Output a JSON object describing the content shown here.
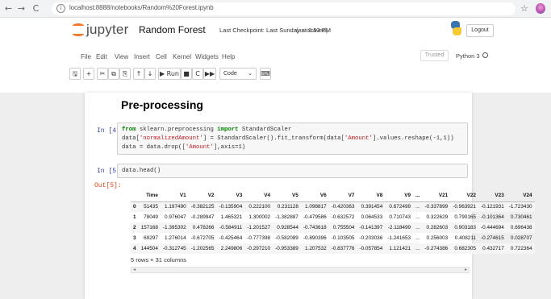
{
  "browser": {
    "back": "←",
    "forward": "→",
    "reload": "C",
    "info_icon": "i",
    "url": "localhost:8888/notebooks/Random%20Forest.ipynb",
    "star": "☆"
  },
  "jupyter": {
    "brand": "jupyter",
    "notebook_title": "Random Forest",
    "checkpoint": "Last Checkpoint: Last Sunday at 8:53 PM",
    "autosave": "(autosaved)",
    "logout": "Logout",
    "trusted": "Trusted",
    "kernel": "Python 3"
  },
  "menu": [
    "File",
    "Edit",
    "View",
    "Insert",
    "Cell",
    "Kernel",
    "Widgets",
    "Help"
  ],
  "toolbar": {
    "save": "🖫",
    "add": "+",
    "cut": "✂",
    "copy": "⧉",
    "paste": "⎘",
    "up": "↑",
    "down": "↓",
    "run": "▶ Run",
    "stop": "■",
    "restart": "C",
    "run_all": "▶▶",
    "cell_type": "Code",
    "cell_type_arrow": "⌄",
    "palette": "⌨"
  },
  "notebook": {
    "heading": "Pre-processing",
    "cell4": {
      "prompt": "In [4]:",
      "line1_kw1": "from",
      "line1_mod": " sklearn.preprocessing ",
      "line1_kw2": "import",
      "line1_rest": " StandardScaler",
      "line2_a": "data[",
      "line2_s1": "'normalizedAmount'",
      "line2_b": "] = StandardScaler().fit_transform(data[",
      "line2_s2": "'Amount'",
      "line2_c": "].values.reshape(-1,1))",
      "line3_a": "data = data.drop([",
      "line3_s": "'Amount'",
      "line3_b": "],axis=1)"
    },
    "cell5": {
      "prompt": "In [5]:",
      "code": "data.head()",
      "out_prompt": "Out[5]:"
    },
    "dataframe": {
      "columns": [
        "",
        "Time",
        "V1",
        "V2",
        "V3",
        "V4",
        "V5",
        "V6",
        "V7",
        "V8",
        "V9",
        "...",
        "V21",
        "V22",
        "V23",
        "V24"
      ],
      "rows": [
        [
          "0",
          "51435",
          "1.197490",
          "-0.382125",
          "-0.135904",
          "0.222100",
          "0.231128",
          "1.098817",
          "-0.420363",
          "0.391454",
          "0.672499",
          "...",
          "-0.337899",
          "-0.963921",
          "-0.121931",
          "-1.723430"
        ],
        [
          "1",
          "78049",
          "0.976047",
          "-0.289947",
          "1.465321",
          "1.300002",
          "-1.382887",
          "-0.479586",
          "-0.632572",
          "0.064533",
          "0.710743",
          "...",
          "0.322629",
          "0.790165",
          "-0.101364",
          "0.730461"
        ],
        [
          "2",
          "157168",
          "-1.395302",
          "0.478266",
          "-0.584911",
          "-1.201527",
          "0.928544",
          "-0.743618",
          "0.755504",
          "-0.141397",
          "-2.118499",
          "...",
          "0.282603",
          "0.903183",
          "-0.444694",
          "0.696438"
        ],
        [
          "3",
          "69297",
          "1.276014",
          "-0.672705",
          "-0.425464",
          "-0.777398",
          "-0.582089",
          "-0.890396",
          "-0.103505",
          "-0.203036",
          "-1.241653",
          "...",
          "0.256003",
          "0.408211",
          "-0.274615",
          "0.028707"
        ],
        [
          "4",
          "144504",
          "-0.312745",
          "-1.202565",
          "2.249806",
          "-0.297210",
          "-0.953389",
          "1.207532",
          "-0.837776",
          "-0.057854",
          "1.121421",
          "...",
          "-0.274386",
          "0.682305",
          "0.432717",
          "0.722364"
        ]
      ],
      "shape": "5 rows × 31 columns"
    }
  },
  "scroll": {
    "left": "◂",
    "right": "▸"
  },
  "colors": {
    "jupyter_orange": "#f37726",
    "prompt_in": "#303f9f",
    "prompt_out": "#d84315"
  }
}
